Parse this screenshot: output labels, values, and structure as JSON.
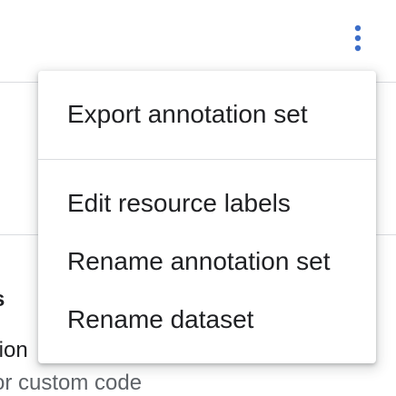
{
  "toolbar": {
    "more_icon": "more-vert-icon",
    "accent_color": "#1a73e8"
  },
  "background": {
    "heading_fragment": "s",
    "row_fragment": "tion",
    "row_fragment_2": "or custom code"
  },
  "menu": {
    "items": [
      {
        "label": "Export annotation set"
      },
      {
        "label": "Edit resource labels"
      },
      {
        "label": "Rename annotation set"
      },
      {
        "label": "Rename dataset"
      }
    ]
  }
}
